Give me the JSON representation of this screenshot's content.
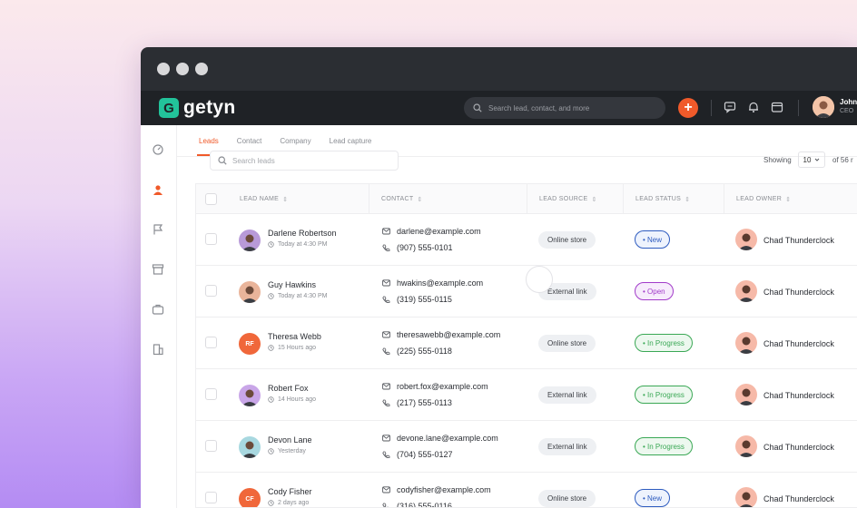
{
  "app": {
    "logo_mark": "G",
    "logo_text": "getyn",
    "search_placeholder": "Search lead, contact, and more",
    "user_name": "John",
    "user_role": "CEO"
  },
  "tabs": [
    {
      "label": "Leads",
      "active": true
    },
    {
      "label": "Contact",
      "active": false
    },
    {
      "label": "Company",
      "active": false
    },
    {
      "label": "Lead capture",
      "active": false
    }
  ],
  "toolbar": {
    "search_placeholder": "Search leads",
    "showing_label": "Showing",
    "page_size": "10",
    "total_label": "of 56 r"
  },
  "columns": {
    "lead_name": "LEAD NAME",
    "contact": "CONTACT",
    "lead_source": "LEAD SOURCE",
    "lead_status": "LEAD STATUS",
    "lead_owner": "LEAD OWNER"
  },
  "rows": [
    {
      "name": "Darlene Robertson",
      "time": "Today at 4:30 PM",
      "email": "darlene@example.com",
      "phone": "(907) 555-0101",
      "source": "Online store",
      "status": "• New",
      "owner": "Chad Thunderclock",
      "initials": "",
      "avatar_color": "#b89ad8"
    },
    {
      "name": "Guy Hawkins",
      "time": "Today at 4:30 PM",
      "email": "hwakins@example.com",
      "phone": "(319) 555-0115",
      "source": "External link",
      "status": "• Open",
      "owner": "Chad Thunderclock",
      "initials": "",
      "avatar_color": "#e9b49a"
    },
    {
      "name": "Theresa Webb",
      "time": "15 Hours ago",
      "email": "theresawebb@example.com",
      "phone": "(225) 555-0118",
      "source": "Online store",
      "status": "• In Progress",
      "owner": "Chad Thunderclock",
      "initials": "RF",
      "avatar_color": "#f0673a"
    },
    {
      "name": "Robert Fox",
      "time": "14 Hours ago",
      "email": "robert.fox@example.com",
      "phone": "(217) 555-0113",
      "source": "External link",
      "status": "• In Progress",
      "owner": "Chad Thunderclock",
      "initials": "",
      "avatar_color": "#c9a6e8"
    },
    {
      "name": "Devon Lane",
      "time": "Yesterday",
      "email": "devone.lane@example.com",
      "phone": "(704) 555-0127",
      "source": "External link",
      "status": "• In Progress",
      "owner": "Chad Thunderclock",
      "initials": "",
      "avatar_color": "#a8d8e0"
    },
    {
      "name": "Cody Fisher",
      "time": "2 days ago",
      "email": "codyfisher@example.com",
      "phone": "(316) 555-0116",
      "source": "Online store",
      "status": "• New",
      "owner": "Chad Thunderclock",
      "initials": "CF",
      "avatar_color": "#f0673a"
    }
  ],
  "status_colors": {
    "new": "#2d5bbf",
    "open": "#a23bc9",
    "in_progress": "#3aa855"
  }
}
